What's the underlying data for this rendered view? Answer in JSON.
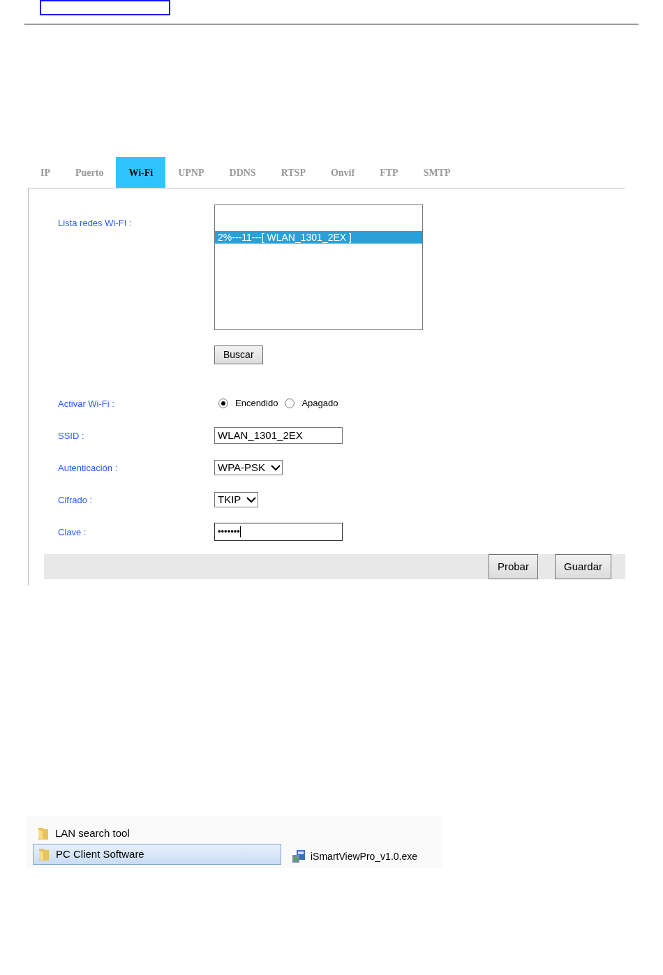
{
  "tabs": [
    {
      "label": "IP",
      "selected": false
    },
    {
      "label": "Puerto",
      "selected": false
    },
    {
      "label": "Wi-Fi",
      "selected": true
    },
    {
      "label": "UPNP",
      "selected": false
    },
    {
      "label": "DDNS",
      "selected": false
    },
    {
      "label": "RTSP",
      "selected": false
    },
    {
      "label": "Onvif",
      "selected": false
    },
    {
      "label": "FTP",
      "selected": false
    },
    {
      "label": "SMTP",
      "selected": false
    }
  ],
  "wifi_list": {
    "label": "Lista redes Wi-FI :",
    "items": [
      {
        "text": "2%---11---[ WLAN_1301_2EX ]",
        "selected": true
      }
    ],
    "search_button": "Buscar"
  },
  "activate": {
    "label": "Activar Wi-Fi :",
    "options": [
      {
        "label": "Encendido",
        "selected": true
      },
      {
        "label": "Apagado",
        "selected": false
      }
    ]
  },
  "fields": [
    {
      "kind": "text",
      "label": "SSID :",
      "value": "WLAN_1301_2EX"
    },
    {
      "kind": "select",
      "label": "Autenticación :",
      "value": "WPA-PSK"
    },
    {
      "kind": "select",
      "label": "Cifrado :",
      "value": "TKIP"
    },
    {
      "kind": "password",
      "label": "Clave :",
      "value": "•••••••"
    }
  ],
  "footer_buttons": [
    "Probar",
    "Guardar"
  ],
  "explorer": {
    "folders": [
      {
        "name": "LAN search tool",
        "selected": false
      },
      {
        "name": "PC Client Software",
        "selected": true
      }
    ],
    "file": "iSmartViewPro_v1.0.exe"
  }
}
